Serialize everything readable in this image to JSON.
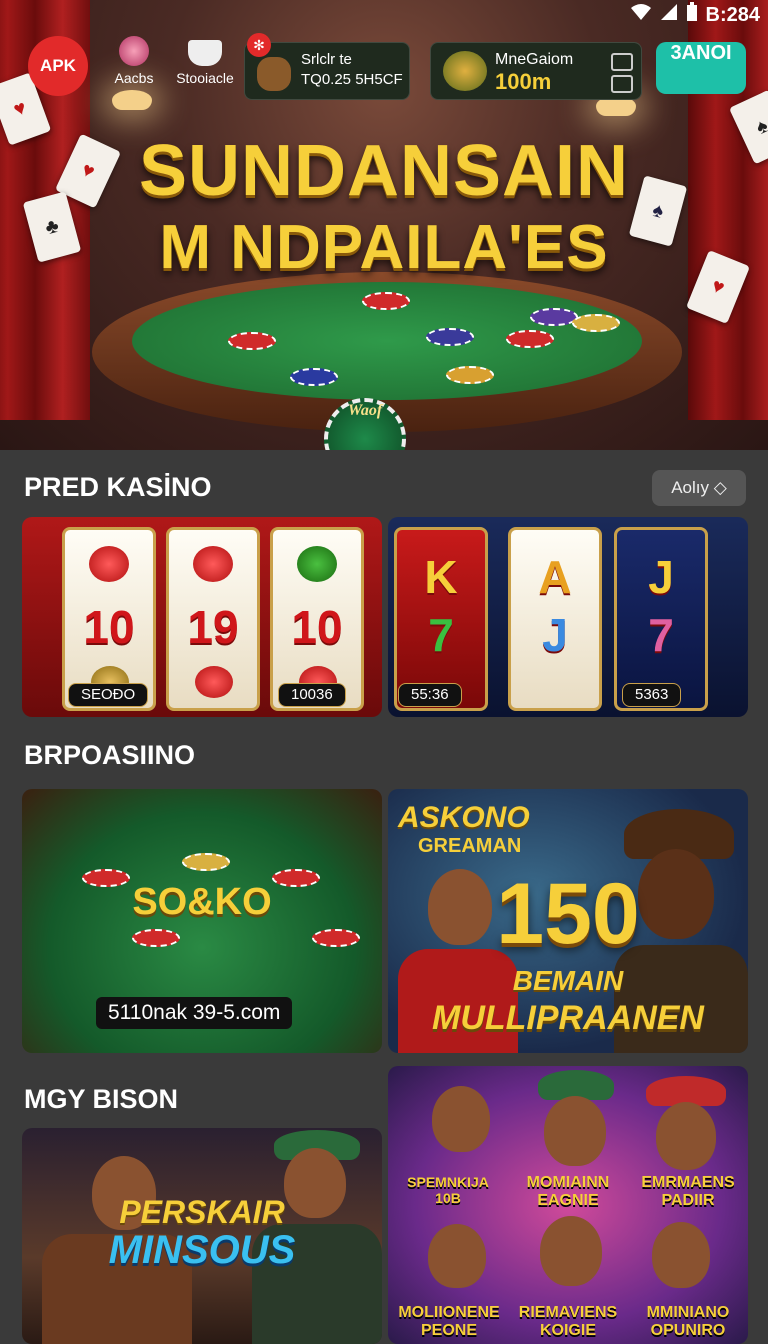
{
  "status_bar": {
    "time": "B:284"
  },
  "top_bar": {
    "logo_text": "APK",
    "items": [
      {
        "label": "Aacbs",
        "icon": "peach-icon"
      },
      {
        "label": "Stooiacle",
        "icon": "cup-icon"
      }
    ],
    "promo_left": {
      "line1": "Srlclr te",
      "line2": "TQ0.25 5H5CF",
      "icon": "squirrel-icon"
    },
    "promo_right": {
      "line1": "MneGaiom",
      "line2": "100m",
      "icon": "frog-icon"
    },
    "action_button": "3ANOI"
  },
  "hero": {
    "title_line1": "SUNDANSAIN",
    "title_line2": "M NDPAILA'ES",
    "center_chip": "Waof"
  },
  "sections": {
    "pred": {
      "title": "PRED KASİNO",
      "button": "Aolıy",
      "slot1": {
        "reels": [
          "10",
          "19",
          "10"
        ],
        "label_left": "SEOĐO",
        "label_right": "10036"
      },
      "slot2": {
        "reels": [
          "K",
          "A",
          "J"
        ],
        "reels_bottom": [
          "7",
          "J",
          "7"
        ],
        "label_left": "55:36",
        "label_right": "5363"
      }
    },
    "brpo": {
      "title": "BRPOASIINO",
      "card1": {
        "title": "SO&KO",
        "caption": "5110nak 39-5.com"
      },
      "card2": {
        "top1": "ASKONO",
        "top2": "GREAMAN",
        "big": "150",
        "sub": "BEMAIN",
        "bottom": "MULLIPRAANEN"
      }
    },
    "mgy": {
      "title": "MGY BISON",
      "card1": {
        "line1": "PERSKAIR",
        "line2": "MINSOUS"
      },
      "card2": {
        "badge1": "SPEMNKIJA 10B",
        "badge2": "MOMIAINN EAGNIE",
        "badge3": "EMRMAENS PADIIR",
        "b1": "MOLIIONENE PEONE",
        "b2": "RIEMAVIENS KOIGIE",
        "b3": "MMINIANO OPUNIRO"
      }
    }
  },
  "colors": {
    "accent_gold": "#f6cf3a",
    "action": "#1ec0a8",
    "brand_red": "#e22a2a"
  }
}
